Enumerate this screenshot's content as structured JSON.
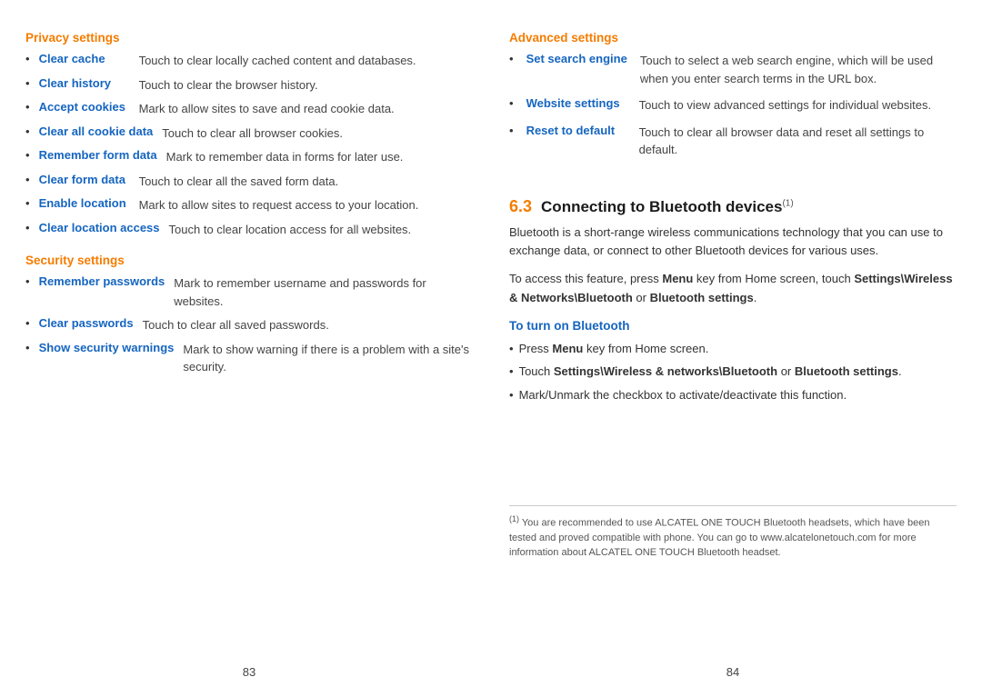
{
  "left_page": {
    "page_number": "83",
    "privacy_section": {
      "header": "Privacy settings",
      "items": [
        {
          "label": "Clear cache",
          "description": "Touch to clear locally cached content and databases."
        },
        {
          "label": "Clear history",
          "description": "Touch to clear the browser history."
        },
        {
          "label": "Accept cookies",
          "description": "Mark to allow sites to save and read cookie data."
        },
        {
          "label": "Clear all cookie data",
          "description": "Touch to clear all browser cookies."
        },
        {
          "label": "Remember form data",
          "description": "Mark to remember data in forms for later use."
        },
        {
          "label": "Clear form data",
          "description": "Touch to clear all the saved form data."
        },
        {
          "label": "Enable location",
          "description": "Mark to allow sites to request access to your location."
        },
        {
          "label": "Clear location access",
          "description": "Touch to clear location access for all websites."
        }
      ]
    },
    "security_section": {
      "header": "Security settings",
      "items": [
        {
          "label": "Remember passwords",
          "description": "Mark to remember username and passwords for websites."
        },
        {
          "label": "Clear passwords",
          "description": "Touch to clear all saved passwords."
        },
        {
          "label": "Show security warnings",
          "description": "Mark to show warning if there is a problem with a site's security."
        }
      ]
    }
  },
  "right_page": {
    "page_number": "84",
    "advanced_section": {
      "header": "Advanced settings",
      "items": [
        {
          "label": "Set search engine",
          "description": "Touch to select a web search engine, which will be used when you enter search terms in the URL box."
        },
        {
          "label": "Website settings",
          "description": "Touch to view advanced settings for individual websites."
        },
        {
          "label": "Reset to default",
          "description": "Touch to clear all browser data and reset all settings to default."
        }
      ]
    },
    "bluetooth_section": {
      "number": "6.3",
      "title": "Connecting to Bluetooth devices",
      "superscript": "(1)",
      "intro": "Bluetooth is a short-range wireless communications technology that you can use to exchange data, or connect to other Bluetooth devices for various uses.",
      "access_text_parts": [
        "To access this feature, press ",
        "Menu",
        " key from Home screen, touch ",
        "Settings\\Wireless & Networks\\Bluetooth",
        " or ",
        "Bluetooth settings",
        "."
      ],
      "turn_on_header": "To turn on Bluetooth",
      "turn_on_steps": [
        {
          "text": "Press ",
          "bold": "Menu",
          "rest": " key from Home screen."
        },
        {
          "text": "Touch ",
          "bold": "Settings\\Wireless & networks\\Bluetooth",
          "mid": " or ",
          "bold2": "Bluetooth settings",
          "rest": "."
        },
        {
          "text": "Mark/Unmark the checkbox to activate/deactivate this function."
        }
      ]
    },
    "footnote": {
      "number": "(1)",
      "text": "You are recommended to use ALCATEL ONE TOUCH Bluetooth headsets, which have been tested and proved compatible with phone. You can go to www.alcatelonetouch.com for more information about ALCATEL ONE TOUCH Bluetooth headset."
    }
  }
}
